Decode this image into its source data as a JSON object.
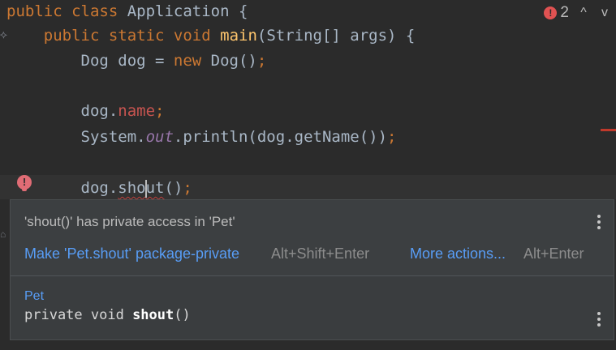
{
  "editor": {
    "lines": [
      {
        "kw": "public class",
        "name": "Application",
        "rest": " {"
      },
      {
        "kw": "public static void",
        "fn": "main",
        "params": "(String[] args) {"
      },
      {
        "a": "Dog dog = ",
        "kw": "new",
        "b": " Dog()",
        "semi": ";"
      },
      {
        "obj": "dog.",
        "field": "name",
        "semi": ";"
      },
      {
        "a": "System.",
        "static": "out",
        "b": ".println(dog.getName())",
        "semi": ";"
      },
      {
        "obj": "dog.",
        "err_a": "sho",
        "err_b": "ut",
        "rest": "()",
        "semi": ";"
      }
    ]
  },
  "inspections": {
    "error_count": "2",
    "error_icon": "!",
    "up_icon": "^",
    "down_icon": "v"
  },
  "popup": {
    "message": "'shout()' has private access in 'Pet'",
    "fix_action": "Make 'Pet.shout' package-private",
    "fix_shortcut": "Alt+Shift+Enter",
    "more_actions": "More actions...",
    "more_shortcut": "Alt+Enter",
    "doc_class": "Pet",
    "doc_signature_prefix": "private void ",
    "doc_signature_name": "shout",
    "doc_signature_suffix": "()"
  },
  "colors": {
    "background": "#2b2b2b",
    "keyword": "#cc7832",
    "method": "#ffc66d",
    "error": "#e05252",
    "link": "#589df6"
  }
}
